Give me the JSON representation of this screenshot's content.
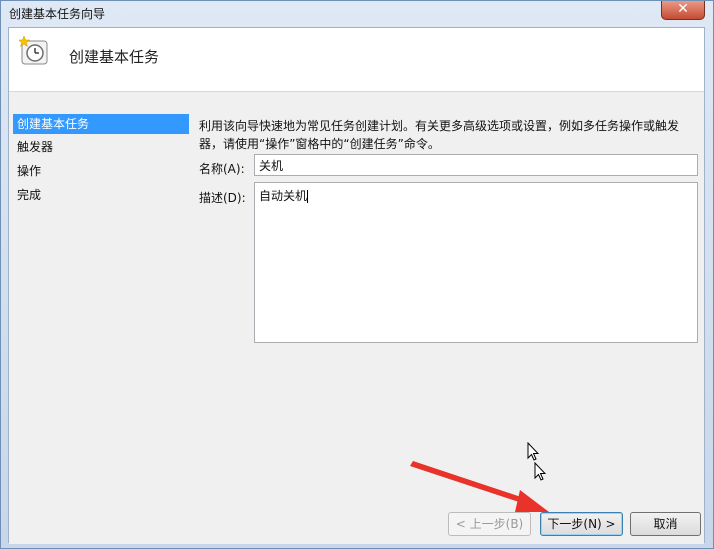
{
  "window": {
    "title": "创建基本任务向导",
    "close_glyph": "✕"
  },
  "header": {
    "title": "创建基本任务",
    "icon": "clock-star-icon"
  },
  "steps": [
    {
      "label": "创建基本任务",
      "active": true
    },
    {
      "label": "触发器"
    },
    {
      "label": "操作"
    },
    {
      "label": "完成"
    }
  ],
  "form": {
    "description_line1": "利用该向导快速地为常见任务创建计划。有关更多高级选项或设置，例如多任务操作或触发",
    "description_line2": "器，请使用“操作”窗格中的“创建任务”命令。",
    "name_label": "名称(A):",
    "name_value": "关机",
    "desc_label": "描述(D):",
    "desc_value": "自动关机"
  },
  "buttons": {
    "back": "< 上一步(B)",
    "next": "下一步(N) >",
    "cancel": "取消"
  },
  "colors": {
    "selection": "#3399ff",
    "annotation_arrow": "#e8322a"
  }
}
